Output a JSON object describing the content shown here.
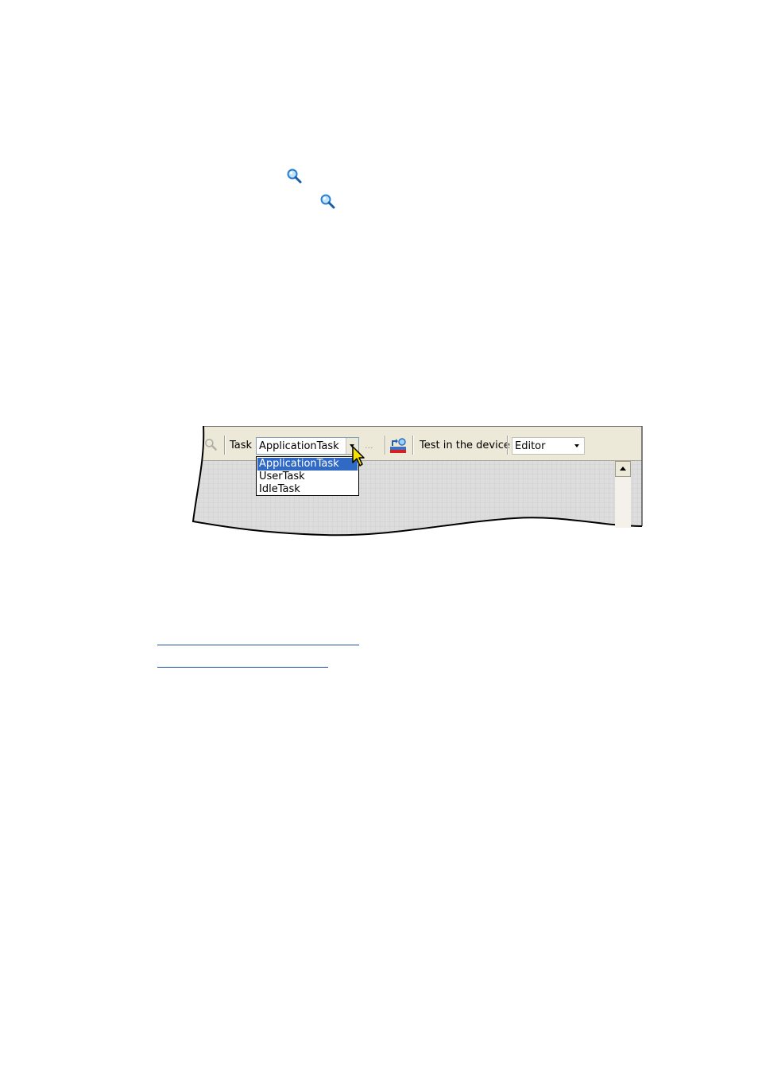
{
  "toolbar": {
    "task_label": "Task",
    "task_value": "ApplicationTask",
    "ellipsis": "...",
    "test_label": "Test in the device",
    "mode_value": "Editor"
  },
  "task_dropdown": {
    "options": [
      "ApplicationTask",
      "UserTask",
      "IdleTask"
    ],
    "selected_index": 0
  },
  "icons": {
    "magnifier": "magnifier-icon",
    "download": "download-to-device-icon",
    "cursor": "mouse-pointer-icon"
  },
  "colors": {
    "selection": "#316ac5",
    "toolbar_bg": "#ece9d8",
    "canvas_bg": "#dcdcdc",
    "link": "#1a50a8"
  }
}
